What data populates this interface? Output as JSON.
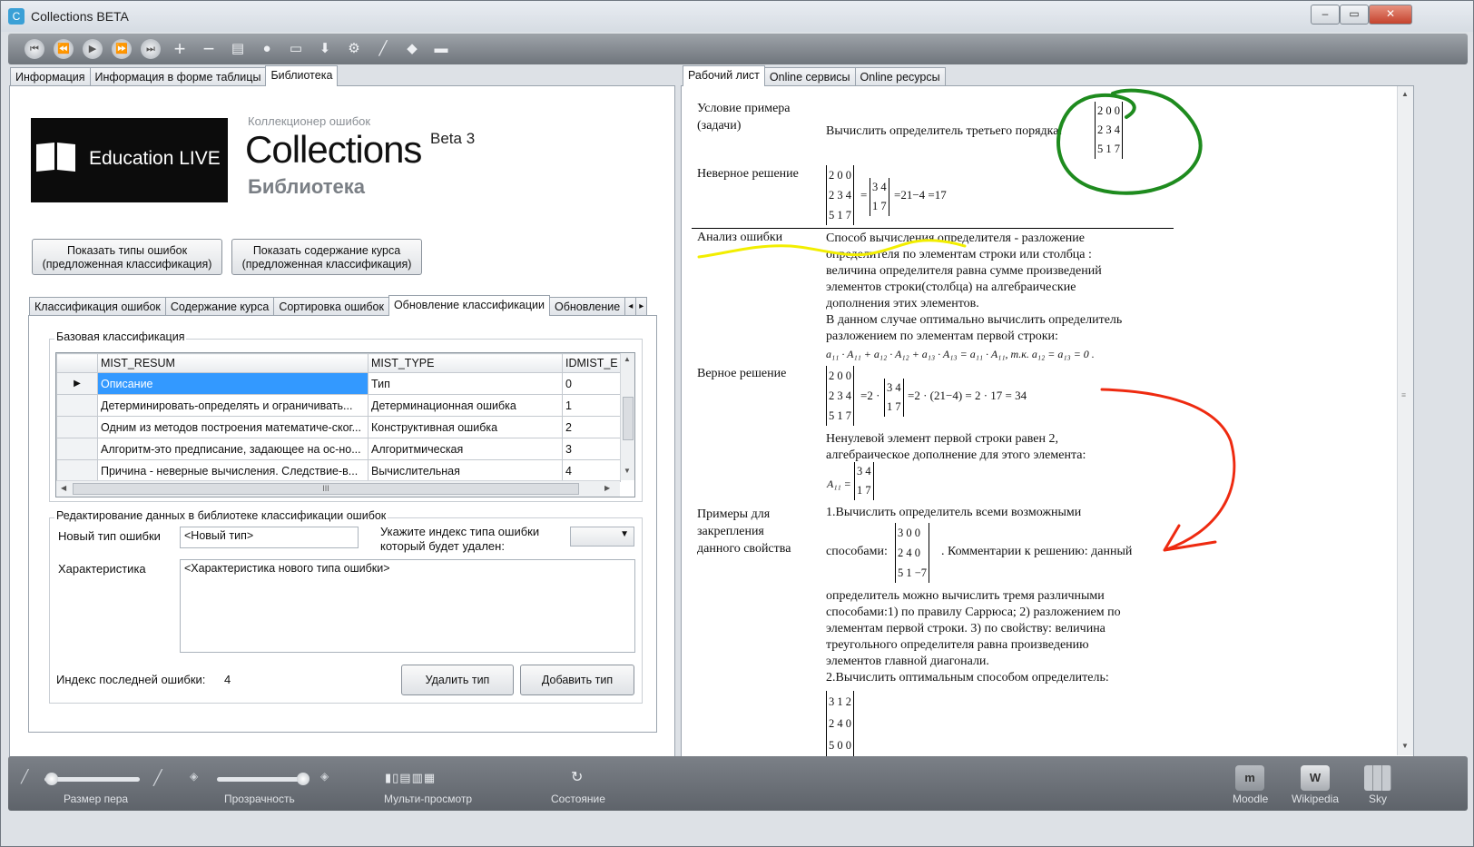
{
  "window": {
    "title": "Collections BETA",
    "minimize": "‒",
    "maximize": "▭",
    "close": "✕"
  },
  "toolbar": {
    "icons": [
      "first-icon",
      "prev-icon",
      "play-icon",
      "next-icon",
      "last-icon",
      "add-icon",
      "remove-icon",
      "document-icon",
      "comment-icon",
      "screen-icon",
      "download-icon",
      "settings-icon",
      "pen-icon",
      "eraser-icon",
      "folder-icon"
    ]
  },
  "left_tabs": [
    "Информация",
    "Информация в форме таблицы",
    "Библиотека"
  ],
  "logo": {
    "text": "Education LIVE"
  },
  "header": {
    "subtitle": "Коллекционер ошибок",
    "title": "Collections",
    "beta": "Beta 3",
    "section": "Библиотека"
  },
  "buttons": {
    "show_types": [
      "Показать типы ошибок",
      "(предложенная классификация)"
    ],
    "show_course": [
      "Показать содержание курса",
      "(предложенная классификация)"
    ]
  },
  "inner_tabs": [
    "Классификация ошибок",
    "Содержание курса",
    "Сортировка ошибок",
    "Обновление классификации",
    "Обновление"
  ],
  "base_group": {
    "label": "Базовая классификация",
    "columns": [
      "MIST_RESUM",
      "MIST_TYPE",
      "IDMIST_E"
    ],
    "rows": [
      [
        "Описание",
        "Тип",
        "0"
      ],
      [
        "Детерминировать-определять и ограничивать...",
        "Детерминационная ошибка",
        "1"
      ],
      [
        "Одним из методов построения математиче-ског...",
        "Конструктивная ошибка",
        "2"
      ],
      [
        "Алгоритм-это предписание, задающее на ос-но...",
        "Алгоритмическая",
        "3"
      ],
      [
        "Причина - неверные вычисления. Следствие-в...",
        "Вычислительная",
        "4"
      ]
    ],
    "scroll_mark": "III"
  },
  "edit_group": {
    "label": "Редактирование данных в библиотеке классификации ошибок",
    "new_type_label": "Новый тип ошибки",
    "new_type_value": "<Новый тип>",
    "delete_index_label": [
      "Укажите индекс типа ошибки",
      "который будет удален:"
    ],
    "characteristic_label": "Характеристика",
    "characteristic_value": "<Характеристика нового типа ошибки>",
    "last_index_label": "Индекс последней ошибки:",
    "last_index_value": "4",
    "delete_button": "Удалить тип",
    "add_button": "Добавить тип"
  },
  "right_tabs": [
    "Рабочий лист",
    "Online сервисы",
    "Online ресурсы"
  ],
  "worksheet": {
    "cond_label": [
      "Условие примера",
      "(задачи)"
    ],
    "cond_text": "Вычислить определитель третьего порядка:",
    "matrix_a": [
      "2 0 0",
      "2 3 4",
      "5 1 7"
    ],
    "wrong_label": "Неверное решение",
    "minor": [
      "3 4",
      "1 7"
    ],
    "wrong_result": "=21−4 =17",
    "analysis_label": "Анализ ошибки",
    "analysis_lines": [
      "Способ вычисления определителя - разложение",
      "определителя по элементам строки или столбца :",
      "величина определителя   равна сумме произведений",
      "элементов строки(столбца) на алгебраические",
      "дополнения этих элементов.",
      "В данном случае оптимально вычислить определитель",
      "разложением по элементам первой строки:"
    ],
    "formula": "a₁₁ · A₁₁ + a₁₂ · A₁₂ + a₁₃ · A₁₃ = a₁₁ · A₁₁, т.к. a₁₂ = a₁₃ = 0 .",
    "correct_label": "Верное решение",
    "correct_result": "=2 · (21−4) = 2 · 17 = 34",
    "correct_mult": "=2 ·",
    "note_lines": [
      "Ненулевой элемент первой строки равен 2,",
      "алгебраическое дополнение для этого элемента:"
    ],
    "a11": "A₁₁ =",
    "examples_label": [
      "Примеры для",
      "закрепления",
      "данного свойства"
    ],
    "ex1": "1.Вычислить определитель всеми возможными",
    "ex1b_pre": "способами:",
    "ex1b_post": ". Комментарии к решению: данный",
    "matrix_b": [
      "3 0   0",
      "2 4   0",
      "5 1 −7"
    ],
    "ex1_lines": [
      "определитель можно вычислить тремя различными",
      "способами:1) по правилу Саррюса; 2) разложением по",
      "элементам первой строки. 3) по свойству: величина",
      "треугольного определителя равна произведению",
      "элементов главной диагонали."
    ],
    "ex2": "2.Вычислить оптимальным способом определитель:",
    "matrix_c": [
      "3 1   2",
      "2 4   0",
      "5 0   0"
    ]
  },
  "bottom": {
    "pen_size": "Размер пера",
    "transparency": "Прозрачность",
    "multi_view": "Мульти-просмотр",
    "state": "Состояние",
    "moodle": "Moodle",
    "wikipedia": "Wikipedia",
    "sky": "Sky",
    "pen_value": 0.0,
    "transparency_value": 1.0
  },
  "colors": {
    "selection": "#3399ff",
    "annotation_green": "#1e8b1e",
    "annotation_yellow": "#f2ee00",
    "annotation_red": "#ee2a10"
  }
}
